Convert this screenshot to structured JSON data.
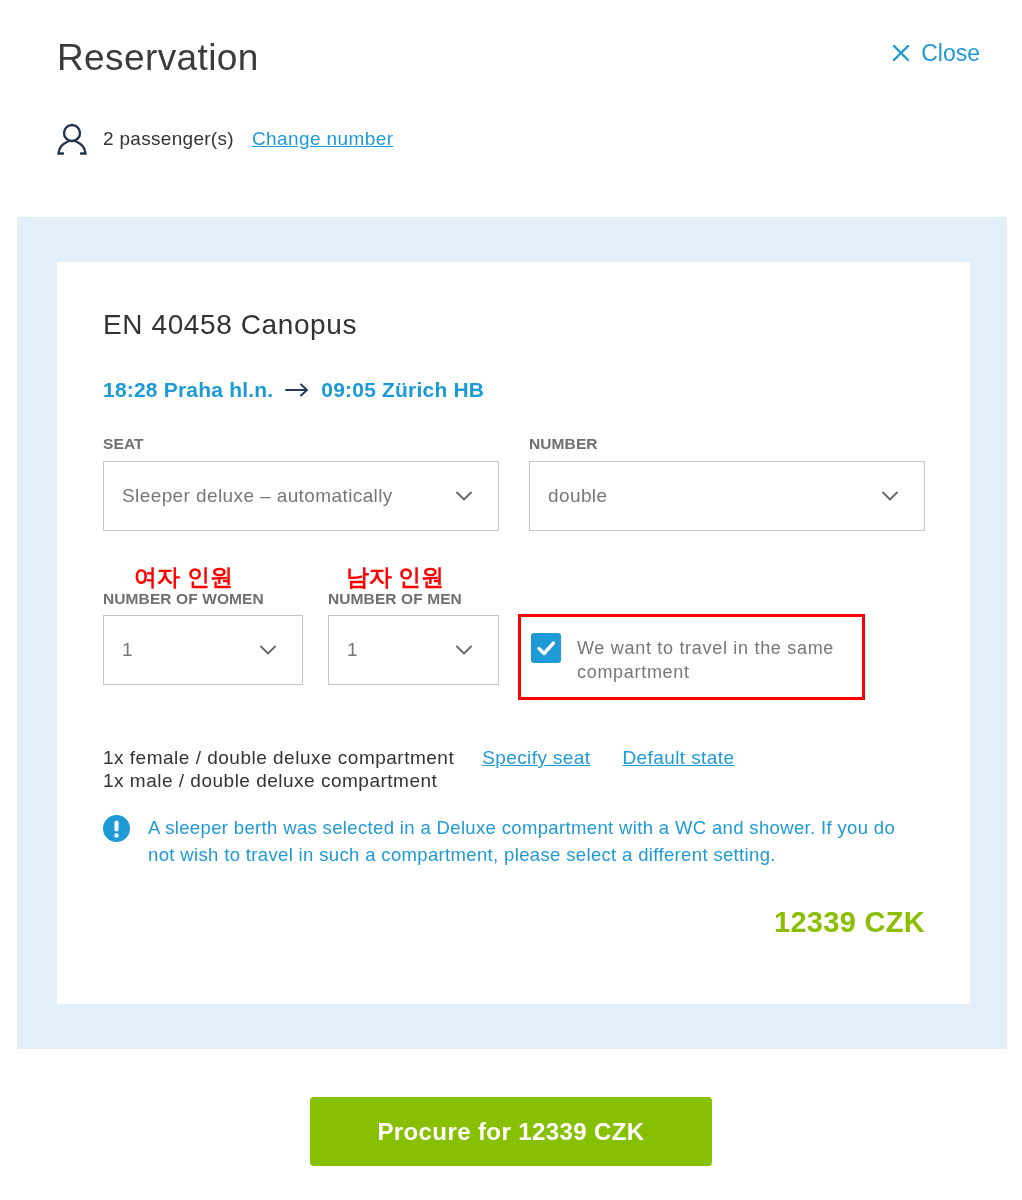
{
  "dialog": {
    "title": "Reservation",
    "close_label": "Close"
  },
  "passengers": {
    "count_text": "2 passenger(s)",
    "change_link": "Change number"
  },
  "train": {
    "name": "EN 40458 Canopus",
    "departure": "18:28 Praha hl.n.",
    "arrival": "09:05 Zürich HB"
  },
  "field_rows": [
    {
      "fields": [
        {
          "kind": "select",
          "label": "SEAT",
          "value": "Sleeper deluxe – automatically"
        },
        {
          "kind": "select",
          "label": "NUMBER",
          "value": "double"
        }
      ]
    },
    {
      "fields": [
        {
          "kind": "select",
          "annotation": "여자 인원",
          "label": "NUMBER OF WOMEN",
          "value": "1"
        },
        {
          "kind": "select",
          "annotation": "남자 인원",
          "label": "NUMBER OF MEN",
          "value": "1"
        },
        {
          "kind": "checkbox",
          "label": "We want to travel in the same compartment",
          "checked": true,
          "highlighted": true
        }
      ]
    }
  ],
  "allocation": {
    "lines": [
      "1x female / double deluxe compartment",
      "1x male / double deluxe compartment"
    ],
    "links": [
      "Specify seat",
      "Default state"
    ]
  },
  "notice": "A sleeper berth was selected in a Deluxe compartment with a WC and shower. If you do not wish to travel in such a compartment, please select a different setting.",
  "price": "12339 CZK",
  "submit_button": "Procure for 12339 CZK"
}
